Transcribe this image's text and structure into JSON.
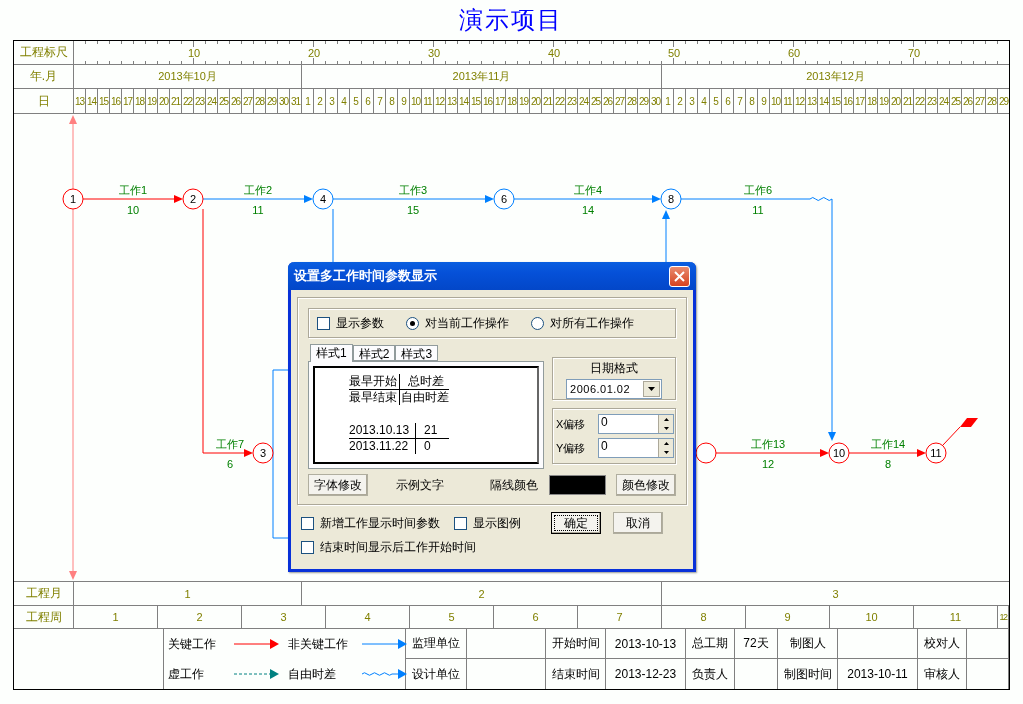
{
  "title": "演示项目",
  "header": {
    "ruler_label": "工程标尺",
    "ruler_marks": [
      "10",
      "20",
      "30",
      "40",
      "50",
      "60",
      "70"
    ],
    "month_label": "年.月",
    "day_label": "日",
    "months": [
      {
        "label": "2013年10月",
        "days": [
          "13",
          "14",
          "15",
          "16",
          "17",
          "18",
          "19",
          "20",
          "21",
          "22",
          "23",
          "24",
          "25",
          "26",
          "27",
          "28",
          "29",
          "30",
          "31"
        ]
      },
      {
        "label": "2013年11月",
        "days": [
          "1",
          "2",
          "3",
          "4",
          "5",
          "6",
          "7",
          "8",
          "9",
          "10",
          "11",
          "12",
          "13",
          "14",
          "15",
          "16",
          "17",
          "18",
          "19",
          "20",
          "21",
          "22",
          "23",
          "24",
          "25",
          "26",
          "27",
          "28",
          "29",
          "30"
        ]
      },
      {
        "label": "2013年12月",
        "days": [
          "1",
          "2",
          "3",
          "4",
          "5",
          "6",
          "7",
          "8",
          "9",
          "10",
          "11",
          "12",
          "13",
          "14",
          "15",
          "16",
          "17",
          "18",
          "19",
          "20",
          "21",
          "22",
          "23",
          "24",
          "25",
          "26",
          "27",
          "28",
          "29"
        ]
      }
    ]
  },
  "network": {
    "nodes": [
      {
        "label": "1",
        "critical": true
      },
      {
        "label": "2",
        "critical": true
      },
      {
        "label": "4",
        "critical": false
      },
      {
        "label": "6",
        "critical": false
      },
      {
        "label": "8",
        "critical": false
      },
      {
        "label": "3",
        "critical": true
      },
      {
        "critical": true
      },
      {
        "label": "10",
        "critical": true
      },
      {
        "label": "11",
        "critical": true
      }
    ],
    "edges": [
      {
        "name": "工作1",
        "duration": "10",
        "critical": true
      },
      {
        "name": "工作2",
        "duration": "11",
        "critical": false
      },
      {
        "name": "工作3",
        "duration": "15",
        "critical": false
      },
      {
        "name": "工作4",
        "duration": "14",
        "critical": false
      },
      {
        "name": "工作6",
        "duration": "11",
        "critical": false
      },
      {
        "name": "工作7",
        "duration": "6",
        "critical": true
      },
      {
        "name": "工作13",
        "duration": "12",
        "critical": true
      },
      {
        "name": "工作14",
        "duration": "8",
        "critical": true
      },
      {
        "critical": false
      },
      {
        "critical": false
      },
      {
        "critical": false
      }
    ]
  },
  "footer": {
    "project_month_label": "工程月",
    "project_months": [
      "1",
      "2",
      "3"
    ],
    "project_week_label": "工程周",
    "project_weeks": [
      "1",
      "2",
      "3",
      "4",
      "5",
      "6",
      "7",
      "8",
      "9",
      "10",
      "11",
      "12"
    ]
  },
  "legend": [
    {
      "label": "关键工作",
      "kind": "critical"
    },
    {
      "label": "非关键工作",
      "kind": "normal"
    },
    {
      "label": "虚工作",
      "kind": "dummy"
    },
    {
      "label": "自由时差",
      "kind": "float"
    }
  ],
  "info_table": [
    [
      {
        "kind": "text",
        "text": "监理单位"
      },
      {
        "kind": "blank"
      },
      {
        "kind": "text",
        "text": "开始时间"
      },
      {
        "kind": "text",
        "text": "2013-10-13"
      },
      {
        "kind": "text",
        "text": "总工期"
      },
      {
        "kind": "text",
        "text": "72天"
      },
      {
        "kind": "text",
        "text": "制图人"
      },
      {
        "kind": "blank"
      },
      {
        "kind": "text",
        "text": "校对人"
      },
      {
        "kind": "blank"
      }
    ],
    [
      {
        "kind": "text",
        "text": "设计单位"
      },
      {
        "kind": "blank"
      },
      {
        "kind": "text",
        "text": "结束时间"
      },
      {
        "kind": "text",
        "text": "2013-12-23"
      },
      {
        "kind": "text",
        "text": "负责人"
      },
      {
        "kind": "blank"
      },
      {
        "kind": "text",
        "text": "制图时间"
      },
      {
        "kind": "text",
        "text": "2013-10-11"
      },
      {
        "kind": "text",
        "text": "审核人"
      },
      {
        "kind": "blank"
      }
    ]
  ],
  "dialog": {
    "title": "设置多工作时间参数显示",
    "options": [
      {
        "kind": "checkbox",
        "label": "显示参数",
        "checked": false
      },
      {
        "kind": "radio",
        "label": "对当前工作操作",
        "selected": true
      },
      {
        "kind": "radio",
        "label": "对所有工作操作",
        "selected": false
      }
    ],
    "tabs": [
      {
        "label": "样式1",
        "selected": true
      },
      {
        "label": "样式2",
        "selected": false
      },
      {
        "label": "样式3",
        "selected": false
      }
    ],
    "preview": {
      "header": [
        [
          "最早开始",
          "总时差"
        ],
        [
          "最早结束",
          "自由时差"
        ]
      ],
      "sample": [
        [
          "2013.10.13",
          "21"
        ],
        [
          "2013.11.22",
          "0"
        ]
      ]
    },
    "date_format": {
      "title": "日期格式",
      "value": "2006.01.02"
    },
    "offsets": [
      {
        "label": "X偏移",
        "value": "0"
      },
      {
        "label": "Y偏移",
        "value": "0"
      }
    ],
    "font_button": "字体修改",
    "sample_text": "示例文字",
    "line_color_label": "隔线颜色",
    "color_button": "颜色修改",
    "footer_options": [
      {
        "label": "新增工作显示时间参数",
        "checked": false
      },
      {
        "label": "显示图例",
        "checked": false
      },
      {
        "label": "结束时间显示后工作开始时间",
        "checked": false
      }
    ],
    "buttons": [
      {
        "label": "确定",
        "focused": true
      },
      {
        "label": "取消",
        "focused": false
      }
    ]
  }
}
